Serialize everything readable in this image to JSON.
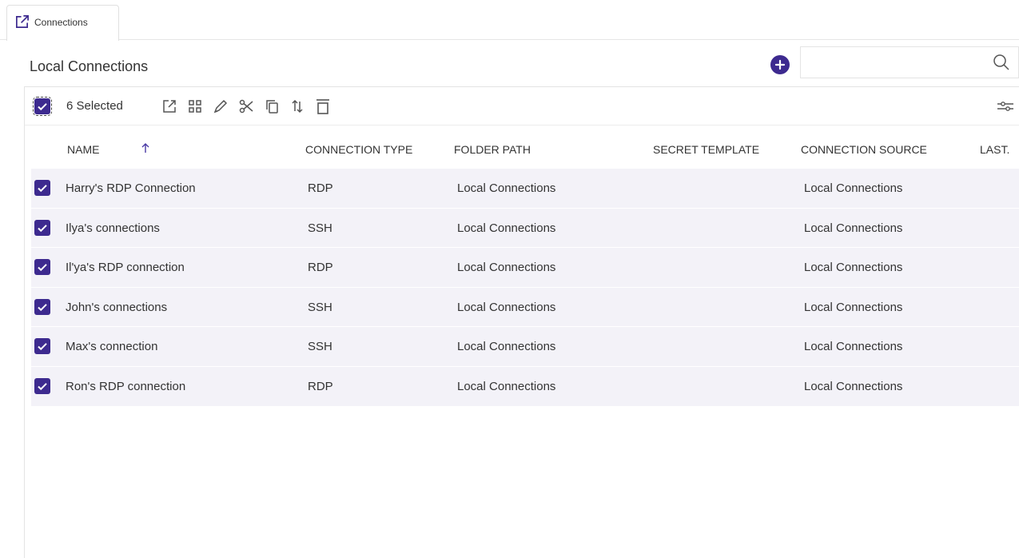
{
  "tab": {
    "label": "Connections"
  },
  "header": {
    "title": "Local Connections",
    "search_placeholder": ""
  },
  "toolbar": {
    "selected_label": "6 Selected",
    "icons": [
      "open-external-icon",
      "grid-icon",
      "edit-pencil-icon",
      "cut-scissors-icon",
      "copy-icon",
      "sort-updown-icon",
      "delete-trash-icon",
      "filter-sliders-icon"
    ]
  },
  "table": {
    "columns": [
      "NAME",
      "CONNECTION TYPE",
      "FOLDER PATH",
      "SECRET TEMPLATE",
      "CONNECTION SOURCE",
      "LAST."
    ],
    "sort": {
      "column": "NAME",
      "direction": "ascending"
    },
    "rows": [
      {
        "checked": true,
        "name": "Harry's RDP Connection",
        "type": "RDP",
        "folder": "Local Connections",
        "template": "",
        "source": "Local Connections"
      },
      {
        "checked": true,
        "name": "Ilya's connections",
        "type": "SSH",
        "folder": "Local Connections",
        "template": "",
        "source": "Local Connections"
      },
      {
        "checked": true,
        "name": "Il'ya's RDP connection",
        "type": "RDP",
        "folder": "Local Connections",
        "template": "",
        "source": "Local Connections"
      },
      {
        "checked": true,
        "name": "John's connections",
        "type": "SSH",
        "folder": "Local Connections",
        "template": "",
        "source": "Local Connections"
      },
      {
        "checked": true,
        "name": "Max's connection",
        "type": "SSH",
        "folder": "Local Connections",
        "template": "",
        "source": "Local Connections"
      },
      {
        "checked": true,
        "name": "Ron's RDP connection",
        "type": "RDP",
        "folder": "Local Connections",
        "template": "",
        "source": "Local Connections"
      }
    ]
  },
  "colors": {
    "accent": "#3d2a8f",
    "row_bg": "#f3f2f8",
    "border": "#e4e4e4"
  }
}
